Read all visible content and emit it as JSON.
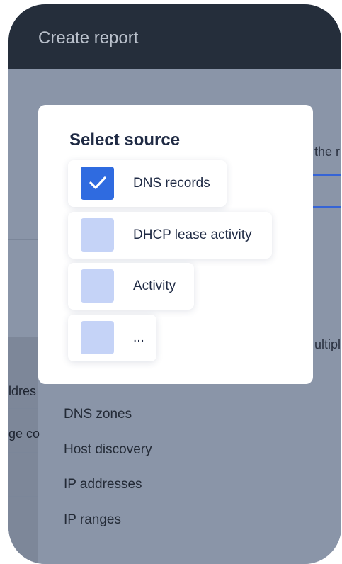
{
  "window": {
    "title": "Create report"
  },
  "background": {
    "partial_texts": [
      "the r",
      "ultipl",
      "ldres",
      "ge co"
    ],
    "report_types": [
      "DNS zones",
      "Host discovery",
      "IP addresses",
      "IP ranges"
    ]
  },
  "modal": {
    "title": "Select source",
    "options": [
      {
        "label": "DNS records",
        "checked": true
      },
      {
        "label": "DHCP lease activity",
        "checked": false
      },
      {
        "label": "Activity",
        "checked": false
      },
      {
        "label": "...",
        "checked": false
      }
    ]
  },
  "colors": {
    "header_bg": "#252e3b",
    "overlay_bg": "#8a95a8",
    "checkbox_checked": "#2f6be0",
    "checkbox_unchecked": "#c5d3f7",
    "title_text": "#1f2a44"
  }
}
